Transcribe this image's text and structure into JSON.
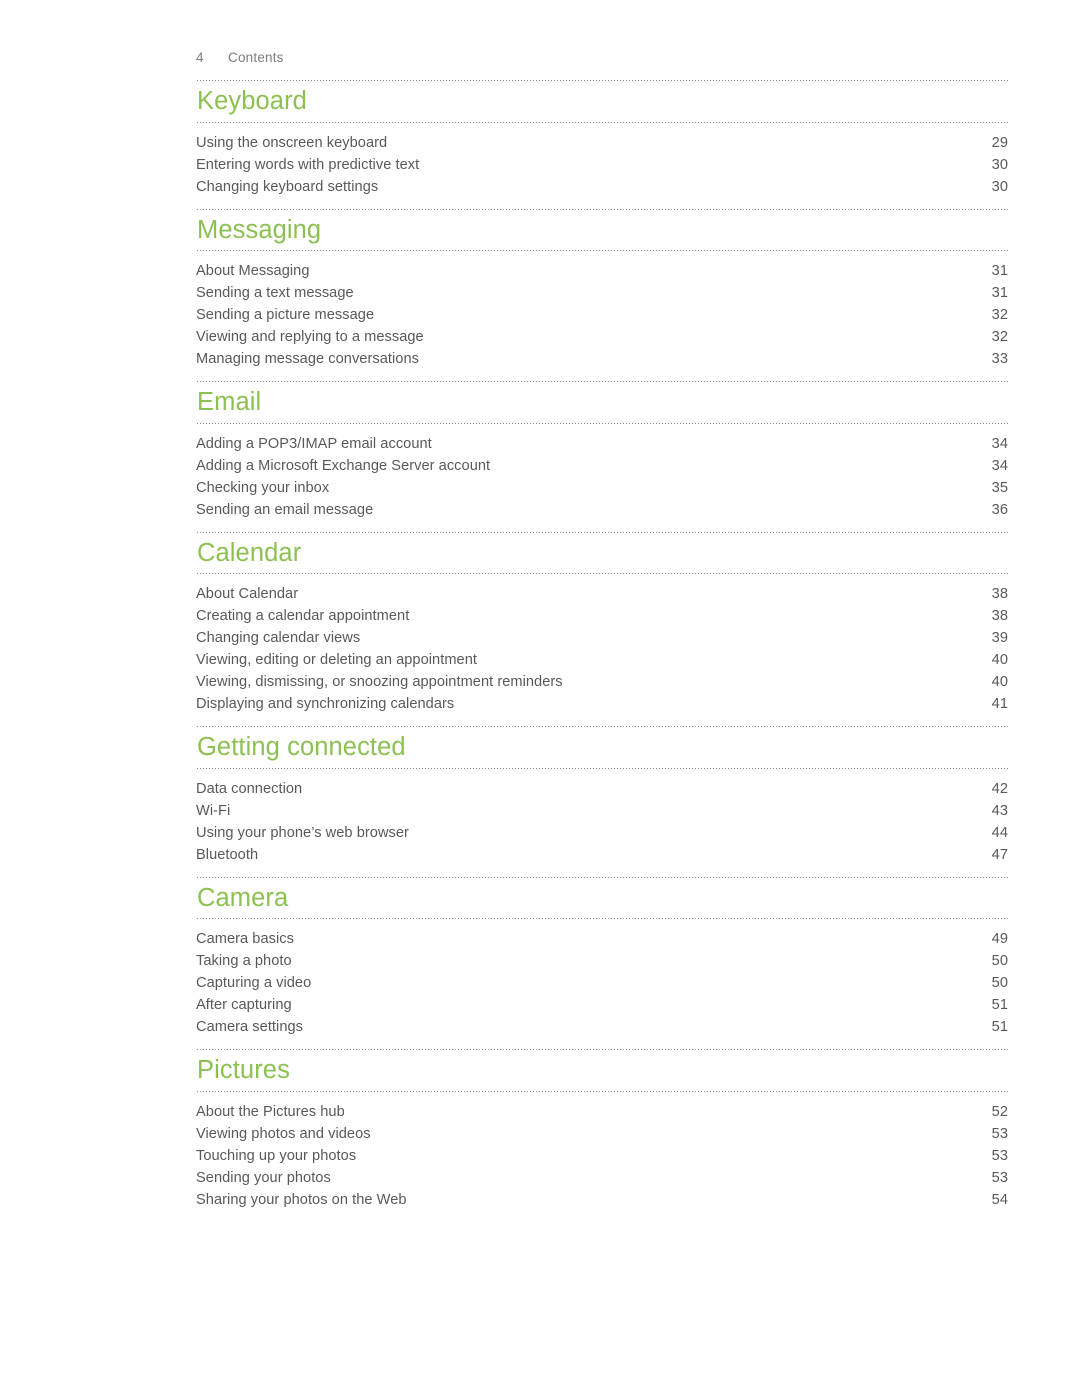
{
  "header": {
    "folio": "4",
    "section_name": "Contents"
  },
  "colors": {
    "heading_green": "#8cc152",
    "body_gray": "#58595b",
    "rule_gray": "#8c8d90",
    "page_background": "#ffffff"
  },
  "sections": [
    {
      "title": "Keyboard",
      "entries": [
        {
          "title": "Using the onscreen keyboard",
          "page": "29"
        },
        {
          "title": "Entering words with predictive text",
          "page": "30"
        },
        {
          "title": "Changing keyboard settings",
          "page": "30"
        }
      ]
    },
    {
      "title": "Messaging",
      "entries": [
        {
          "title": "About Messaging",
          "page": "31"
        },
        {
          "title": "Sending a text message",
          "page": "31"
        },
        {
          "title": "Sending a picture message",
          "page": "32"
        },
        {
          "title": "Viewing and replying to a message",
          "page": "32"
        },
        {
          "title": "Managing message conversations",
          "page": "33"
        }
      ]
    },
    {
      "title": "Email",
      "entries": [
        {
          "title": "Adding a POP3/IMAP email account",
          "page": "34"
        },
        {
          "title": "Adding a Microsoft Exchange Server account",
          "page": "34"
        },
        {
          "title": "Checking your inbox",
          "page": "35"
        },
        {
          "title": "Sending an email message",
          "page": "36"
        }
      ]
    },
    {
      "title": "Calendar",
      "entries": [
        {
          "title": "About Calendar",
          "page": "38"
        },
        {
          "title": "Creating a calendar appointment",
          "page": "38"
        },
        {
          "title": "Changing calendar views",
          "page": "39"
        },
        {
          "title": "Viewing, editing or deleting an appointment",
          "page": "40"
        },
        {
          "title": "Viewing, dismissing, or snoozing appointment reminders",
          "page": "40"
        },
        {
          "title": "Displaying and synchronizing calendars",
          "page": "41"
        }
      ]
    },
    {
      "title": "Getting connected",
      "entries": [
        {
          "title": "Data connection",
          "page": "42"
        },
        {
          "title": "Wi-Fi",
          "page": "43"
        },
        {
          "title": "Using your phone’s web browser",
          "page": "44"
        },
        {
          "title": "Bluetooth",
          "page": "47"
        }
      ]
    },
    {
      "title": "Camera",
      "entries": [
        {
          "title": "Camera basics",
          "page": "49"
        },
        {
          "title": "Taking a photo",
          "page": "50"
        },
        {
          "title": "Capturing a video",
          "page": "50"
        },
        {
          "title": "After capturing",
          "page": "51"
        },
        {
          "title": "Camera settings",
          "page": "51"
        }
      ]
    },
    {
      "title": "Pictures",
      "entries": [
        {
          "title": "About the Pictures hub",
          "page": "52"
        },
        {
          "title": "Viewing photos and videos",
          "page": "53"
        },
        {
          "title": "Touching up your photos",
          "page": "53"
        },
        {
          "title": "Sending your photos",
          "page": "53"
        },
        {
          "title": "Sharing your photos on the Web",
          "page": "54"
        }
      ]
    }
  ]
}
